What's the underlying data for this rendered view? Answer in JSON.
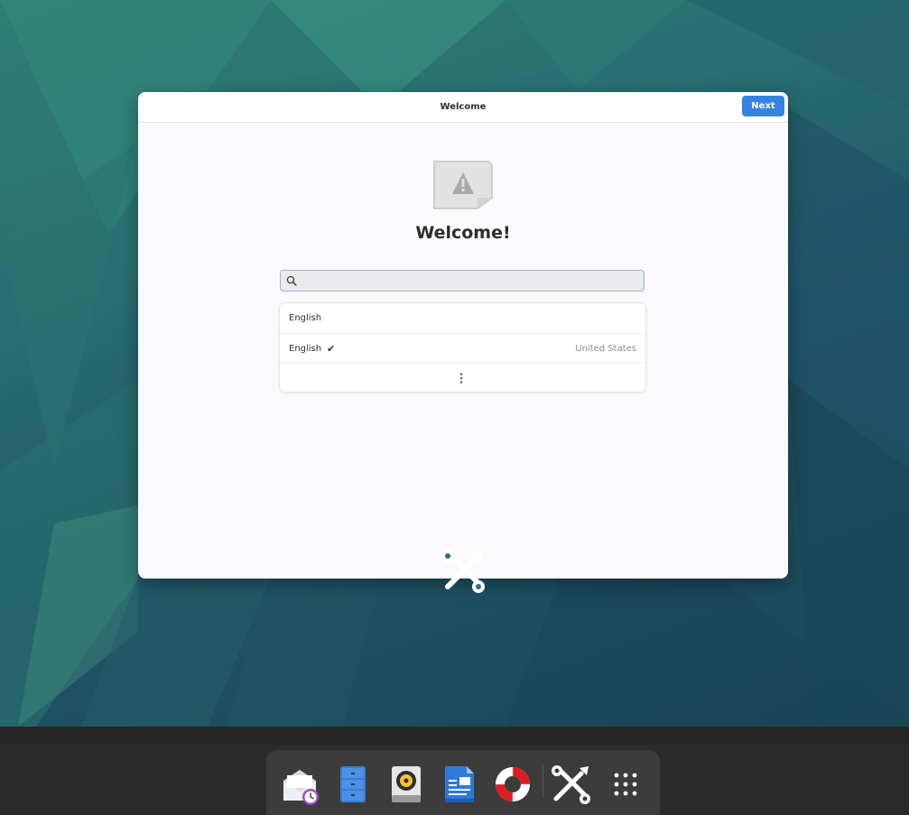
{
  "window": {
    "title": "Welcome",
    "next_label": "Next"
  },
  "main": {
    "heading": "Welcome!",
    "search_placeholder": ""
  },
  "language_list": {
    "rows": [
      {
        "language": "English",
        "selected": false,
        "region": ""
      },
      {
        "language": "English",
        "selected": true,
        "region": "United States"
      }
    ],
    "more_icon": "vertical-ellipsis-icon"
  },
  "dock": {
    "apps": [
      {
        "name": "evolution-mail-calendar"
      },
      {
        "name": "files"
      },
      {
        "name": "rhythmbox"
      },
      {
        "name": "libreoffice-writer"
      },
      {
        "name": "help"
      },
      {
        "name": "tweaks"
      },
      {
        "name": "show-applications"
      }
    ]
  },
  "colors": {
    "accent": "#3584e4",
    "panel": "#2b2b2b",
    "dock": "#3c3c3c"
  }
}
